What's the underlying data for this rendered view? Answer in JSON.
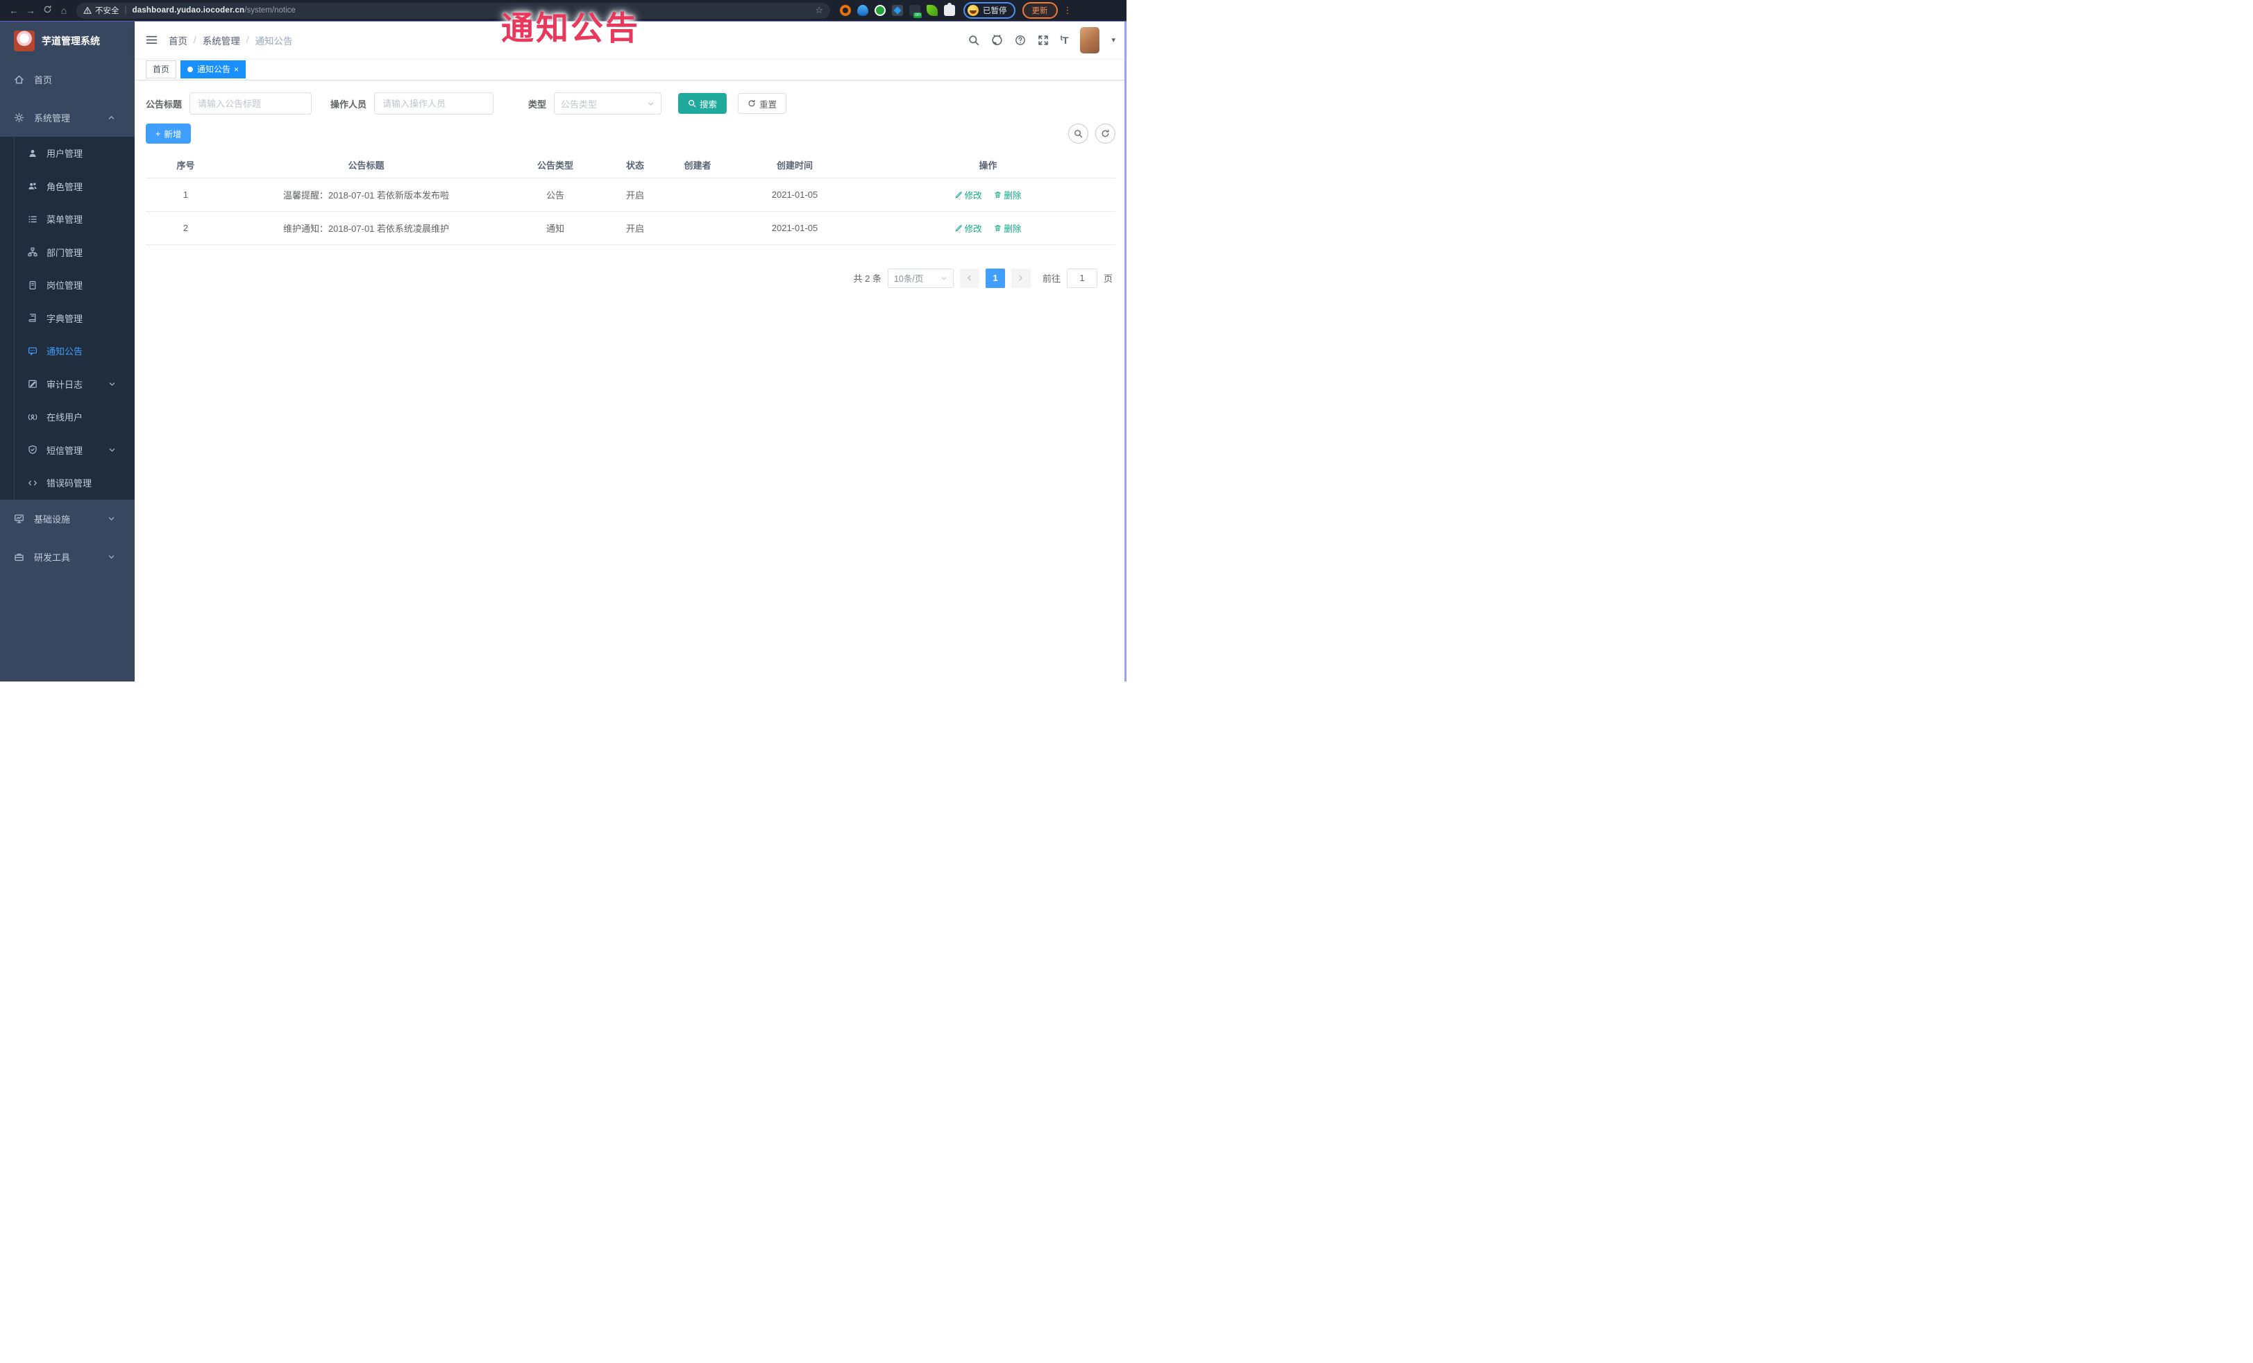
{
  "overlay": {
    "title": "通知公告"
  },
  "glyphs": {
    "back": "←",
    "forward": "→",
    "home": "⌂",
    "star": "☆",
    "caret": "▾",
    "divider": "|",
    "dots": "⋮",
    "plus": "+"
  },
  "browser": {
    "security_label": "不安全",
    "url_host": "dashboard.yudao.iocoder.cn",
    "url_path": "/system/notice",
    "profile_label": "已暂停",
    "update_label": "更新"
  },
  "sidebar": {
    "logo_title": "芋道管理系统",
    "items": [
      {
        "label": "首页"
      },
      {
        "label": "系统管理",
        "arrow": "up"
      },
      {
        "label": "用户管理"
      },
      {
        "label": "角色管理"
      },
      {
        "label": "菜单管理"
      },
      {
        "label": "部门管理"
      },
      {
        "label": "岗位管理"
      },
      {
        "label": "字典管理"
      },
      {
        "label": "通知公告",
        "active": true
      },
      {
        "label": "审计日志",
        "arrow": "down"
      },
      {
        "label": "在线用户"
      },
      {
        "label": "短信管理",
        "arrow": "down"
      },
      {
        "label": "错误码管理"
      },
      {
        "label": "基础设施",
        "arrow": "down"
      },
      {
        "label": "研发工具",
        "arrow": "down"
      }
    ]
  },
  "header": {
    "breadcrumb": {
      "items": [
        "首页",
        "系统管理",
        "通知公告"
      ],
      "separator": "/"
    }
  },
  "tabs": [
    {
      "label": "首页"
    },
    {
      "label": "通知公告",
      "close": "×"
    }
  ],
  "filters": {
    "title_label": "公告标题",
    "title_placeholder": "请输入公告标题",
    "operator_label": "操作人员",
    "operator_placeholder": "请输入操作人员",
    "type_label": "类型",
    "type_placeholder": "公告类型",
    "search_label": "搜索",
    "reset_label": "重置"
  },
  "toolbar": {
    "add_label": "新增"
  },
  "table": {
    "columns": [
      "序号",
      "公告标题",
      "公告类型",
      "状态",
      "创建者",
      "创建时间",
      "操作"
    ],
    "rows": [
      {
        "no": "1",
        "title": "温馨提醒：2018-07-01 若依新版本发布啦",
        "type": "公告",
        "status": "开启",
        "creator": "",
        "created": "2021-01-05"
      },
      {
        "no": "2",
        "title": "维护通知：2018-07-01 若依系统凌晨维护",
        "type": "通知",
        "status": "开启",
        "creator": "",
        "created": "2021-01-05"
      }
    ],
    "edit_label": "修改",
    "delete_label": "删除"
  },
  "pagination": {
    "total": "共 2 条",
    "size": "10条/页",
    "page": "1",
    "goto": "前往",
    "unit": "页",
    "jump": "1"
  },
  "colors": {
    "accent": "#409eff",
    "active_tab": "#1890ff",
    "search_button": "#20aa9e",
    "action_link": "#11a983",
    "overlay_pink": "#e8395c",
    "sidebar_bg": "#37475f",
    "submenu_bg": "#1f2d3d"
  }
}
